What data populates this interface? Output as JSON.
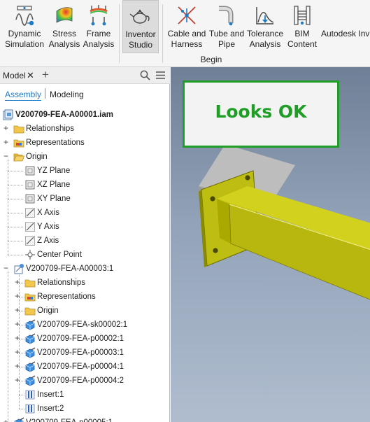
{
  "ribbon": {
    "buttons": [
      {
        "id": "dynamic-simulation",
        "label": "Dynamic\nSimulation",
        "icon": "dynamic-simulation-icon"
      },
      {
        "id": "stress-analysis",
        "label": "Stress\nAnalysis",
        "icon": "stress-analysis-icon"
      },
      {
        "id": "frame-analysis",
        "label": "Frame\nAnalysis",
        "icon": "frame-analysis-icon"
      },
      {
        "id": "inventor-studio",
        "label": "Inventor\nStudio",
        "icon": "teapot-icon",
        "active": true
      },
      {
        "id": "cable-and-harness",
        "label": "Cable and\nHarness",
        "icon": "cable-harness-icon"
      },
      {
        "id": "tube-and-pipe",
        "label": "Tube and\nPipe",
        "icon": "tube-pipe-icon"
      },
      {
        "id": "tolerance-analysis",
        "label": "Tolerance\nAnalysis",
        "icon": "tolerance-analysis-icon"
      },
      {
        "id": "bim-content",
        "label": "BIM\nContent",
        "icon": "bim-content-icon"
      },
      {
        "id": "autodesk-inventor",
        "label": "Autodesk Inv",
        "icon": "autodesk-icon"
      }
    ],
    "group_label": "Begin"
  },
  "browser": {
    "title": "Model",
    "close_glyph": "✕",
    "add_glyph": "+",
    "tabs": {
      "assembly": "Assembly",
      "modeling": "Modeling"
    },
    "tree": [
      {
        "label": "V200709-FEA-A00001.iam",
        "icon": "assembly-doc-icon",
        "expander": "none"
      },
      {
        "label": "Relationships",
        "icon": "folder-icon",
        "expander": "+"
      },
      {
        "label": "Representations",
        "icon": "representations-folder-icon",
        "expander": "+"
      },
      {
        "label": "Origin",
        "icon": "folder-open-icon",
        "expander": "−"
      },
      {
        "label": "YZ Plane",
        "icon": "work-plane-icon",
        "expander": "none"
      },
      {
        "label": "XZ Plane",
        "icon": "work-plane-icon",
        "expander": "none"
      },
      {
        "label": "XY Plane",
        "icon": "work-plane-icon",
        "expander": "none"
      },
      {
        "label": "X Axis",
        "icon": "work-axis-icon",
        "expander": "none"
      },
      {
        "label": "Y Axis",
        "icon": "work-axis-icon",
        "expander": "none"
      },
      {
        "label": "Z Axis",
        "icon": "work-axis-icon",
        "expander": "none"
      },
      {
        "label": "Center Point",
        "icon": "center-point-icon",
        "expander": "none"
      },
      {
        "label": "V200709-FEA-A00003:1",
        "icon": "subassembly-icon",
        "expander": "−"
      },
      {
        "label": "Relationships",
        "icon": "folder-icon",
        "expander": "+"
      },
      {
        "label": "Representations",
        "icon": "representations-folder-icon",
        "expander": "+"
      },
      {
        "label": "Origin",
        "icon": "folder-icon",
        "expander": "+"
      },
      {
        "label": "V200709-FEA-sk00002:1",
        "icon": "part-icon",
        "expander": "+"
      },
      {
        "label": "V200709-FEA-p00002:1",
        "icon": "part-icon",
        "expander": "+"
      },
      {
        "label": "V200709-FEA-p00003:1",
        "icon": "part-icon",
        "expander": "+"
      },
      {
        "label": "V200709-FEA-p00004:1",
        "icon": "part-icon",
        "expander": "+"
      },
      {
        "label": "V200709-FEA-p00004:2",
        "icon": "part-icon",
        "expander": "+"
      },
      {
        "label": "Insert:1",
        "icon": "insert-constraint-icon",
        "expander": "none"
      },
      {
        "label": "Insert:2",
        "icon": "insert-constraint-icon",
        "expander": "none"
      },
      {
        "label": "V200709-FEA-p00005:1",
        "icon": "part-icon",
        "expander": "+"
      }
    ]
  },
  "viewport": {
    "note_text": "Looks OK",
    "colors": {
      "note_border": "#1e9e25",
      "beam": "#c7c71a",
      "plate_gray": "#b8b8b8"
    }
  }
}
